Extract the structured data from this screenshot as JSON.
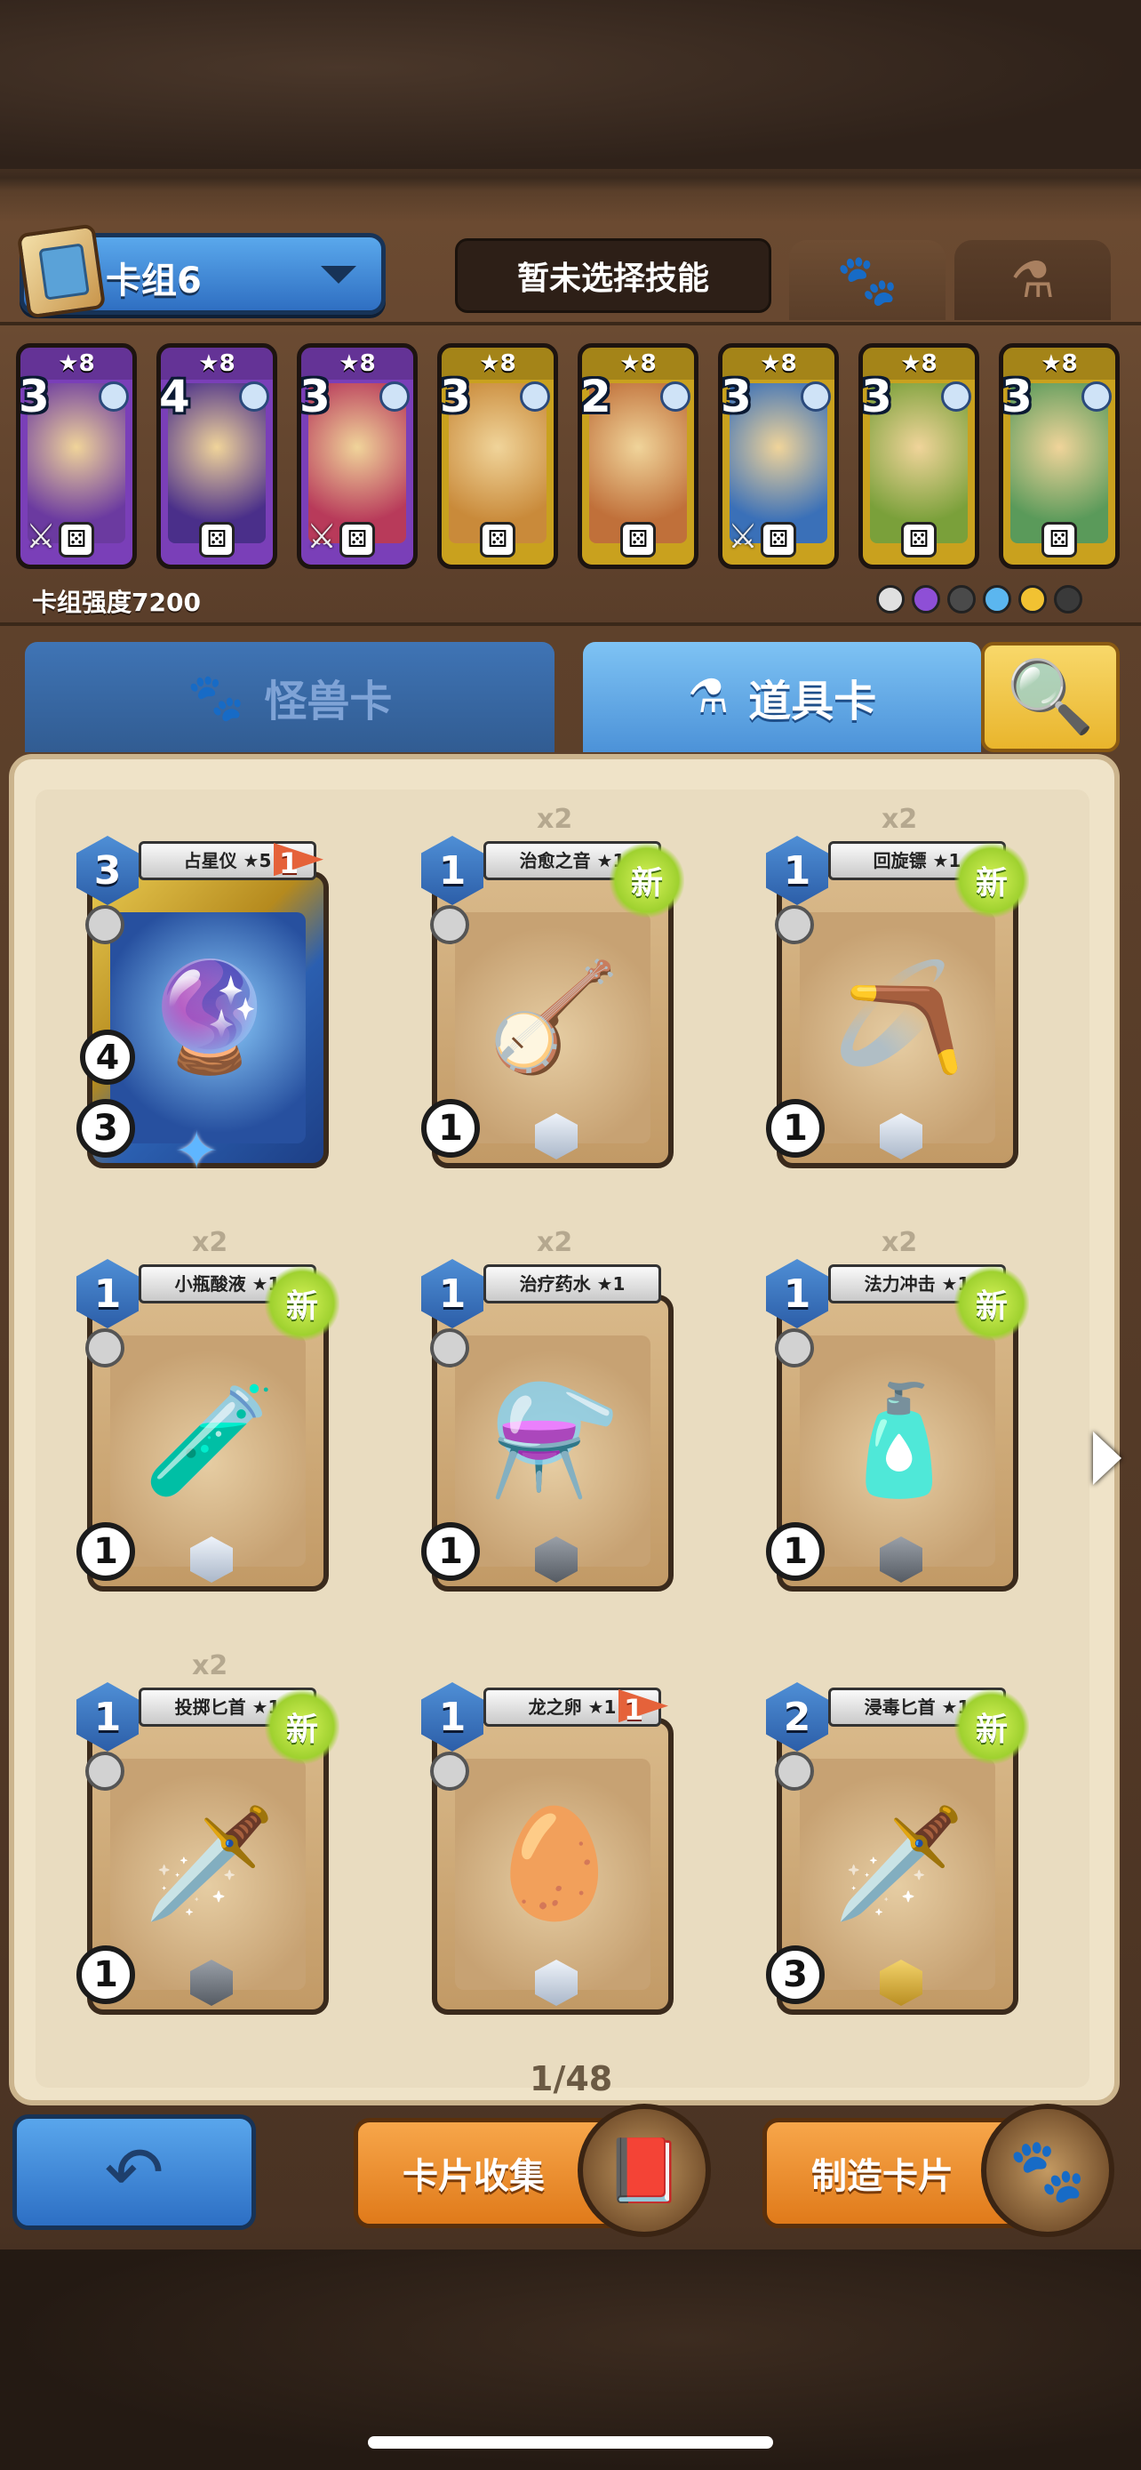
{
  "header": {
    "deck_name": "卡组6",
    "skill_status": "暂未选择技能",
    "tab_paw_icon": "paw-icon",
    "tab_flask_icon": "flask-icon"
  },
  "deck": {
    "cards": [
      {
        "cost": "3",
        "stars": "★8",
        "rarity_color": "#7a3fb8",
        "weapon": true
      },
      {
        "cost": "4",
        "stars": "★8",
        "rarity_color": "#7a3fb8",
        "weapon": false
      },
      {
        "cost": "3",
        "stars": "★8",
        "rarity_color": "#7a3fb8",
        "weapon": true
      },
      {
        "cost": "3",
        "stars": "★8",
        "rarity_color": "#c9a11e",
        "weapon": false
      },
      {
        "cost": "2",
        "stars": "★8",
        "rarity_color": "#c9a11e",
        "weapon": false
      },
      {
        "cost": "3",
        "stars": "★8",
        "rarity_color": "#c9a11e",
        "weapon": true
      },
      {
        "cost": "3",
        "stars": "★8",
        "rarity_color": "#c9a11e",
        "weapon": false
      },
      {
        "cost": "3",
        "stars": "★8",
        "rarity_color": "#c9a11e",
        "weapon": false
      }
    ],
    "strength_label": "卡组强度7200",
    "element_colors": [
      "#e0e0e0",
      "#8e4fd6",
      "#4a4a4a",
      "#5bb6ef",
      "#f1c232",
      "#3a3a3a"
    ]
  },
  "categories": {
    "monster_label": "怪兽卡",
    "item_label": "道具卡",
    "search_icon": "magnifier-icon"
  },
  "items": [
    {
      "name": "占星仪 ★5",
      "cost": "3",
      "copies": "",
      "new": false,
      "flag": "1",
      "ring": "3",
      "ring2": "4",
      "hex": "",
      "special": true,
      "art": "🔮"
    },
    {
      "name": "治愈之音 ★1",
      "cost": "1",
      "copies": "x2",
      "new": true,
      "flag": "",
      "ring": "1",
      "hex": "hex",
      "art": "🪕"
    },
    {
      "name": "回旋镖 ★1",
      "cost": "1",
      "copies": "x2",
      "new": true,
      "flag": "",
      "ring": "1",
      "hex": "hex",
      "art": "🪃"
    },
    {
      "name": "小瓶酸液 ★1",
      "cost": "1",
      "copies": "x2",
      "new": true,
      "flag": "",
      "ring": "1",
      "hex": "hex",
      "art": "🧪"
    },
    {
      "name": "治疗药水 ★1",
      "cost": "1",
      "copies": "x2",
      "new": false,
      "flag": "",
      "ring": "1",
      "hex": "hexd",
      "art": "⚗️"
    },
    {
      "name": "法力冲击 ★1",
      "cost": "1",
      "copies": "x2",
      "new": true,
      "flag": "",
      "ring": "1",
      "hex": "hexd",
      "art": "🧴"
    },
    {
      "name": "投掷匕首 ★1",
      "cost": "1",
      "copies": "x2",
      "new": true,
      "flag": "",
      "ring": "1",
      "hex": "hexd",
      "art": "🗡️"
    },
    {
      "name": "龙之卵 ★1",
      "cost": "1",
      "copies": "",
      "new": false,
      "flag": "1",
      "ring": "",
      "hex": "hex",
      "art": "🥚"
    },
    {
      "name": "浸毒匕首 ★1",
      "cost": "2",
      "copies": "",
      "new": true,
      "flag": "",
      "ring": "3",
      "hex": "hexg",
      "art": "🗡️"
    }
  ],
  "pager": {
    "text": "1/48"
  },
  "bottom": {
    "back_icon": "back-arrow-icon",
    "collect_label": "卡片收集",
    "craft_label": "制造卡片"
  }
}
